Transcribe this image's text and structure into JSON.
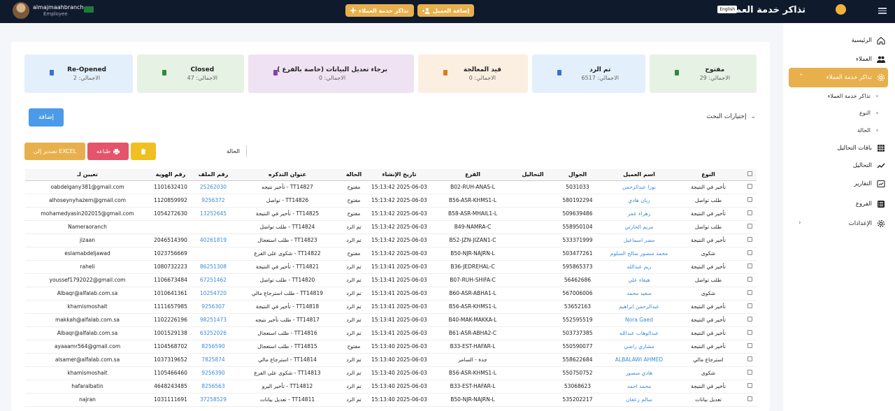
{
  "header": {
    "title": "تذاكر خدمة العملاء",
    "lang_badge": "English",
    "add_client_label": "إضافة العميل",
    "tickets_label": "تذاكر خدمة العملاء",
    "user_name": "almajmaahbranch",
    "user_role": "Employee"
  },
  "sidebar": {
    "items": [
      {
        "label": "الرئيسية",
        "icon": "home-icon"
      },
      {
        "label": "العملاء",
        "icon": "users-icon"
      },
      {
        "label": "تذاكر خدمة العملاء",
        "icon": "gear-icon"
      },
      {
        "label": "باقات التحاليل",
        "icon": "grid-icon"
      },
      {
        "label": "التحاليل",
        "icon": "chart-line-icon"
      },
      {
        "label": "التقارير",
        "icon": "report-icon"
      },
      {
        "label": "الفروع",
        "icon": "branches-icon"
      },
      {
        "label": "الإعدادات",
        "icon": "settings-icon"
      }
    ],
    "sub_items": [
      "تذاكر خدمة العملاء",
      "النوع",
      "الحالة"
    ]
  },
  "cards": [
    {
      "label": "مفتوح",
      "value": "الاجمالي: 29",
      "bg": "#e6f2e4",
      "icon_color": "#2e8b3a"
    },
    {
      "label": "تم الرد",
      "value": "الاجمالي: 6517",
      "bg": "#e3effa",
      "icon_color": "#3a6fd6"
    },
    {
      "label": "قيد المعالجة",
      "value": "الاجمالي: 0",
      "bg": "#fbefe1",
      "icon_color": "#e07a1e"
    },
    {
      "label": "برجاء تعديل البيانات (خاصة بالفرع )",
      "value": "الاجمالي: 0",
      "bg": "#efe3f3",
      "icon_color": "#8a3fb0"
    },
    {
      "label": "Closed",
      "value": "الاجمالي: 47",
      "bg": "#e6f2e4",
      "icon_color": "#2e8b3a"
    },
    {
      "label": "Re-Opened",
      "value": "الاجمالي: 2",
      "bg": "#e3effa",
      "icon_color": "#3a6fd6"
    }
  ],
  "toolbar": {
    "search_options": "إختيارات البحث",
    "add_label": "إضافة",
    "print_label": "طباعه",
    "excel_label": "تصدير إلى EXCEL",
    "status_label": "الحالة"
  },
  "table": {
    "headers": [
      "",
      "النوع",
      "اسم العميل",
      "الجوال",
      "التحاليل",
      "الفرع",
      "تاريخ الإنشاء",
      "الحالة",
      "عنوان التذكره",
      "رقم الملف",
      "رقم الهوية",
      "تعيين لـ"
    ],
    "rows": [
      [
        "تأخير في النتيجة",
        "نورا عبدالرحمن",
        "5031033",
        "",
        "B02-RUH-ANAS-L",
        "2025-06-03 15:13:42",
        "مفتوح",
        "TT14827 - تأخير نتيجه",
        "25262030",
        "1101632410",
        "oabdelgany381@gmail.com"
      ],
      [
        "طلب تواصل",
        "ريان هادي",
        "580192294",
        "",
        "B56-ASR-KHMS1-L",
        "2025-06-03 15:13:42",
        "مفتوح",
        "TT14826 - تواصل",
        "9256372",
        "1120859992",
        "alhoseynyhazem@gmail.com"
      ],
      [
        "تأخير في النتيجة",
        "زهراء عمر",
        "509639486",
        "",
        "B58-ASR-MHAIL1-L",
        "2025-06-03 15:13:42",
        "مفتوح",
        "TT14825 - تأخير في النتيجة",
        "13252645",
        "1054272630",
        "mohamedyasin202015@gmail.com"
      ],
      [
        "طلب تواصل",
        "مريم الحارثي",
        "558950104",
        "",
        "B49-NAMRA-C",
        "2025-06-03 15:13:42",
        "تم الرد",
        "TT14824 - طلب تواصل",
        "",
        "",
        "Nameraoranch"
      ],
      [
        "تأخير في النتيجة",
        "مضر اسماعيل",
        "533371999",
        "",
        "B52-JZN-JIZAN1-C",
        "2025-06-03 15:13:42",
        "تم الرد",
        "TT14823 - طلب استعجال",
        "40261819",
        "2046514390",
        "jizaan"
      ],
      [
        "شكوى",
        "محمد منصور صالح السلوم",
        "503477261",
        "",
        "B50-NJR-NAJRN-L",
        "2025-06-03 15:13:42",
        "مفتوح",
        "TT14822 - شكوى على الفرع",
        "",
        "1023756669",
        "eslamabdeljawad"
      ],
      [
        "تأخير في النتيجة",
        "ريم عبدالله",
        "595865373",
        "",
        "B36-JEDREHAL-C",
        "2025-06-03 15:13:41",
        "تم الرد",
        "TT14821 - تأخير في النتيجة",
        "86251308",
        "1080732223",
        "raheli"
      ],
      [
        "طلب تواصل",
        "هيفاء علي",
        "56462686",
        "",
        "B07-RUH-SHIFA-C",
        "2025-06-03 15:13:41",
        "تم الرد",
        "TT14820 - طلب تواصل",
        "67251462",
        "1106673484",
        "youssef1792022@gmail.com"
      ],
      [
        "شكوى",
        "سعيد محمد",
        "567006006",
        "",
        "B60-ASR-ABHA1-L",
        "2025-06-03 15:13:41",
        "تم الرد",
        "TT14819 - طلب استرجاع مالي",
        "10254720",
        "1010641361",
        "Albaqr@alfalab.com.sa"
      ],
      [
        "تأخير في النتيجة",
        "عبدالرحمن ابراهيم",
        "53652163",
        "",
        "B56-ASR-KHMS1-L",
        "2025-06-03 15:13:41",
        "تم الرد",
        "TT14818 - تأخير في النتيجة",
        "9256307",
        "1111657985",
        "khamismoshait"
      ],
      [
        "تأخير في النتيجة",
        "Nora Gaed",
        "552595519",
        "",
        "B40-MAK-MAKKA-L",
        "2025-06-03 15:13:41",
        "تم الرد",
        "TT14817 - طلب تأخير نتيجه",
        "98251473",
        "1102226196",
        "makkah@alfalab.com.sa"
      ],
      [
        "تأخير في النتيجة",
        "عبدالوهاب عبدالله",
        "503737385",
        "",
        "B61-ASR-ABHA2-C",
        "2025-06-03 15:13:41",
        "تم الرد",
        "TT14816 - طلب استعجال",
        "63252026",
        "1001529138",
        "Albaqr@alfalab.com.sa"
      ],
      [
        "تأخير في النتيجة",
        "مشاري راضي",
        "550590077",
        "",
        "B33-EST-HAFAR-L",
        "2025-06-03 15:13:40",
        "مفتوح",
        "TT14815 - طلب استعجال",
        "8256590",
        "1104568702",
        "ayaaamr564@gmail.com"
      ],
      [
        "استرجاع مالي",
        "ALBALAWI AHMED",
        "558622684",
        "",
        "جدة - السامر",
        "2025-06-03 15:13:40",
        "تم الرد",
        "TT14814 - استرجاع مالي",
        "7825874",
        "1037319652",
        "alsamer@alfalab.com.sa"
      ],
      [
        "شكوى",
        "هادي منصور",
        "550750752",
        "",
        "B56-ASR-KHMS1-L",
        "2025-06-03 15:13:40",
        "تم الرد",
        "TT14813 - شكوى على الفرع",
        "9256390",
        "1105466460",
        "khamismoshait"
      ],
      [
        "تأخير في النتيجة",
        "محمد احمد",
        "53068623",
        "",
        "B33-EST-HAFAR-L",
        "2025-06-03 15:13:40",
        "تم الرد",
        "TT14812 - تأخير اليرو",
        "8256563",
        "4648243485",
        "hafaralbatin"
      ],
      [
        "تعديل بيانات",
        "سالم زعفان",
        "535202217",
        "",
        "B50-NJR-NAJRN-L",
        "2025-06-03 15:13:40",
        "تم الرد",
        "TT14811 - تعديل بيانات",
        "37258529",
        "1031111691",
        "najran"
      ]
    ]
  }
}
